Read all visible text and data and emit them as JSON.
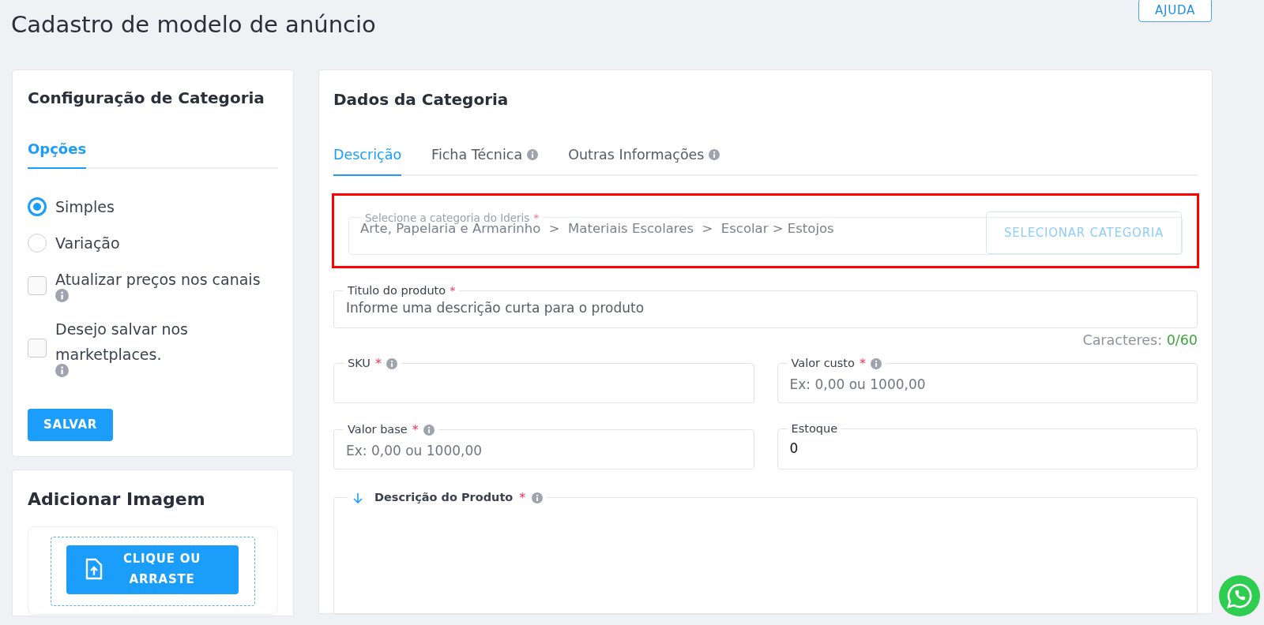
{
  "page": {
    "title": "Cadastro de modelo de anúncio",
    "help_button": "AJUDA"
  },
  "config_card": {
    "title": "Configuração de Categoria",
    "tabs": [
      {
        "label": "Opções",
        "selected": true
      }
    ],
    "options": [
      {
        "kind": "radio",
        "label": "Simples",
        "checked": true,
        "info": false
      },
      {
        "kind": "radio",
        "label": "Variação",
        "checked": false,
        "info": false
      },
      {
        "kind": "checkbox",
        "label": "Atualizar preços nos canais",
        "checked": false,
        "info": true
      },
      {
        "kind": "checkbox",
        "label": "Desejo salvar nos marketplaces.",
        "checked": false,
        "info": true
      }
    ],
    "save_button": "SALVAR"
  },
  "image_card": {
    "title": "Adicionar Imagem",
    "upload_button": "CLIQUE OU ARRASTE"
  },
  "main_card": {
    "title": "Dados da Categoria",
    "tabs": [
      {
        "label": "Descrição",
        "selected": true,
        "info": false
      },
      {
        "label": "Ficha Técnica",
        "selected": false,
        "info": true
      },
      {
        "label": "Outras Informações",
        "selected": false,
        "info": true
      }
    ],
    "category_field": {
      "label": "Selecione a categoria do Ideris",
      "required_mark": "*",
      "value": "Arte, Papelaria e Armarinho  >  Materiais Escolares  >  Escolar > Estojos",
      "button": "SELECIONAR CATEGORIA",
      "highlighted": true
    },
    "title_field": {
      "label": "Titulo do produto",
      "required_mark": "*",
      "placeholder": "Informe uma descrição curta para o produto"
    },
    "char_counter": {
      "label": "Caracteres:",
      "count": "0/60"
    },
    "fields": [
      {
        "label": "SKU",
        "required_mark": "*",
        "info": true
      },
      {
        "label": "Valor custo",
        "required_mark": "*",
        "info": true,
        "placeholder": "Ex: 0,00 ou 1000,00"
      },
      {
        "label": "Valor base",
        "required_mark": "*",
        "info": true,
        "placeholder": "Ex: 0,00 ou 1000,00"
      },
      {
        "label": "Estoque",
        "info": false,
        "value": "0"
      }
    ],
    "description": {
      "label": "Descrição do Produto",
      "required_mark": "*",
      "info": true
    }
  }
}
